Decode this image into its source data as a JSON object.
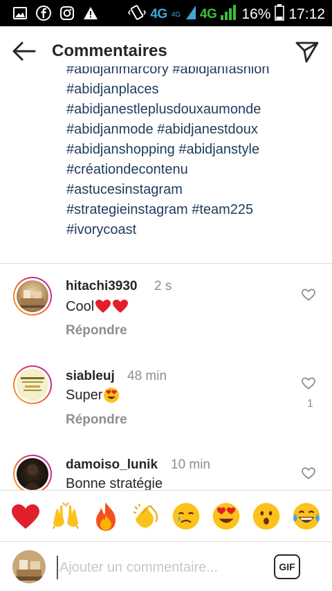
{
  "status_bar": {
    "net1": "4G",
    "net1_sup": "4G",
    "net2": "4G",
    "battery": "16%",
    "time": "17:12"
  },
  "header": {
    "title": "Commentaires"
  },
  "caption": {
    "hashtags": [
      "#abidjanmarcory #abidjanfashion",
      "#abidjanplaces",
      "#abidjanestleplusdouxaumonde",
      "#abidjanmode #abidjanestdoux",
      "#abidjanshopping #abidjanstyle",
      "#créationdecontenu",
      "#astucesinstagram",
      "#strategieinstagram #team225",
      "#ivorycoast"
    ]
  },
  "comments": [
    {
      "username": "hitachi3930",
      "time": "2 s",
      "text": "Cool",
      "emoji": "red-heart x2",
      "reply": "Répondre",
      "likes": ""
    },
    {
      "username": "siableuj",
      "time": "48 min",
      "text": "Super",
      "emoji": "heart-eyes",
      "reply": "Répondre",
      "likes": "1"
    },
    {
      "username": "damoiso_lunik",
      "time": "10 min",
      "text": "Bonne stratégie",
      "emoji": "",
      "reply": "",
      "likes": ""
    }
  ],
  "emoji_bar": [
    "red-heart",
    "raising-hands",
    "fire",
    "clapping-hands",
    "crying-face",
    "heart-eyes",
    "astonished-face",
    "tears-of-joy"
  ],
  "composer": {
    "placeholder": "Ajouter un commentaire...",
    "gif_label": "GIF"
  }
}
